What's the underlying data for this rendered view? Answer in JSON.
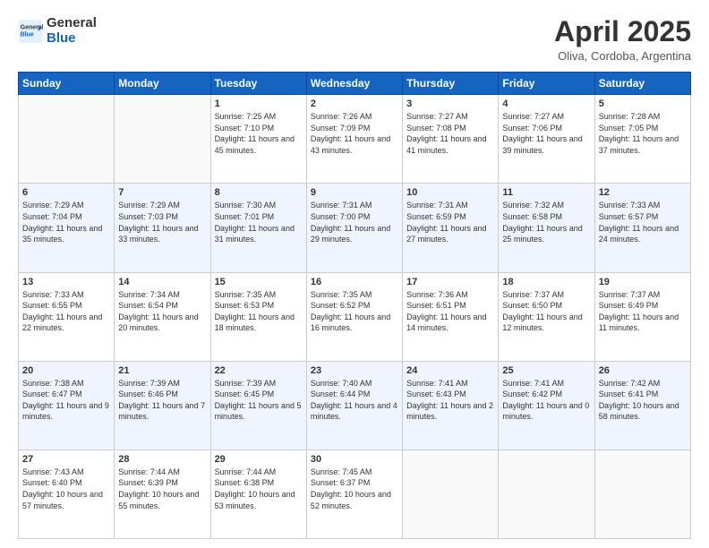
{
  "header": {
    "logo_general": "General",
    "logo_blue": "Blue",
    "month_title": "April 2025",
    "location": "Oliva, Cordoba, Argentina"
  },
  "days_of_week": [
    "Sunday",
    "Monday",
    "Tuesday",
    "Wednesday",
    "Thursday",
    "Friday",
    "Saturday"
  ],
  "weeks": [
    [
      {
        "day": "",
        "sunrise": "",
        "sunset": "",
        "daylight": ""
      },
      {
        "day": "",
        "sunrise": "",
        "sunset": "",
        "daylight": ""
      },
      {
        "day": "1",
        "sunrise": "Sunrise: 7:25 AM",
        "sunset": "Sunset: 7:10 PM",
        "daylight": "Daylight: 11 hours and 45 minutes."
      },
      {
        "day": "2",
        "sunrise": "Sunrise: 7:26 AM",
        "sunset": "Sunset: 7:09 PM",
        "daylight": "Daylight: 11 hours and 43 minutes."
      },
      {
        "day": "3",
        "sunrise": "Sunrise: 7:27 AM",
        "sunset": "Sunset: 7:08 PM",
        "daylight": "Daylight: 11 hours and 41 minutes."
      },
      {
        "day": "4",
        "sunrise": "Sunrise: 7:27 AM",
        "sunset": "Sunset: 7:06 PM",
        "daylight": "Daylight: 11 hours and 39 minutes."
      },
      {
        "day": "5",
        "sunrise": "Sunrise: 7:28 AM",
        "sunset": "Sunset: 7:05 PM",
        "daylight": "Daylight: 11 hours and 37 minutes."
      }
    ],
    [
      {
        "day": "6",
        "sunrise": "Sunrise: 7:29 AM",
        "sunset": "Sunset: 7:04 PM",
        "daylight": "Daylight: 11 hours and 35 minutes."
      },
      {
        "day": "7",
        "sunrise": "Sunrise: 7:29 AM",
        "sunset": "Sunset: 7:03 PM",
        "daylight": "Daylight: 11 hours and 33 minutes."
      },
      {
        "day": "8",
        "sunrise": "Sunrise: 7:30 AM",
        "sunset": "Sunset: 7:01 PM",
        "daylight": "Daylight: 11 hours and 31 minutes."
      },
      {
        "day": "9",
        "sunrise": "Sunrise: 7:31 AM",
        "sunset": "Sunset: 7:00 PM",
        "daylight": "Daylight: 11 hours and 29 minutes."
      },
      {
        "day": "10",
        "sunrise": "Sunrise: 7:31 AM",
        "sunset": "Sunset: 6:59 PM",
        "daylight": "Daylight: 11 hours and 27 minutes."
      },
      {
        "day": "11",
        "sunrise": "Sunrise: 7:32 AM",
        "sunset": "Sunset: 6:58 PM",
        "daylight": "Daylight: 11 hours and 25 minutes."
      },
      {
        "day": "12",
        "sunrise": "Sunrise: 7:33 AM",
        "sunset": "Sunset: 6:57 PM",
        "daylight": "Daylight: 11 hours and 24 minutes."
      }
    ],
    [
      {
        "day": "13",
        "sunrise": "Sunrise: 7:33 AM",
        "sunset": "Sunset: 6:55 PM",
        "daylight": "Daylight: 11 hours and 22 minutes."
      },
      {
        "day": "14",
        "sunrise": "Sunrise: 7:34 AM",
        "sunset": "Sunset: 6:54 PM",
        "daylight": "Daylight: 11 hours and 20 minutes."
      },
      {
        "day": "15",
        "sunrise": "Sunrise: 7:35 AM",
        "sunset": "Sunset: 6:53 PM",
        "daylight": "Daylight: 11 hours and 18 minutes."
      },
      {
        "day": "16",
        "sunrise": "Sunrise: 7:35 AM",
        "sunset": "Sunset: 6:52 PM",
        "daylight": "Daylight: 11 hours and 16 minutes."
      },
      {
        "day": "17",
        "sunrise": "Sunrise: 7:36 AM",
        "sunset": "Sunset: 6:51 PM",
        "daylight": "Daylight: 11 hours and 14 minutes."
      },
      {
        "day": "18",
        "sunrise": "Sunrise: 7:37 AM",
        "sunset": "Sunset: 6:50 PM",
        "daylight": "Daylight: 11 hours and 12 minutes."
      },
      {
        "day": "19",
        "sunrise": "Sunrise: 7:37 AM",
        "sunset": "Sunset: 6:49 PM",
        "daylight": "Daylight: 11 hours and 11 minutes."
      }
    ],
    [
      {
        "day": "20",
        "sunrise": "Sunrise: 7:38 AM",
        "sunset": "Sunset: 6:47 PM",
        "daylight": "Daylight: 11 hours and 9 minutes."
      },
      {
        "day": "21",
        "sunrise": "Sunrise: 7:39 AM",
        "sunset": "Sunset: 6:46 PM",
        "daylight": "Daylight: 11 hours and 7 minutes."
      },
      {
        "day": "22",
        "sunrise": "Sunrise: 7:39 AM",
        "sunset": "Sunset: 6:45 PM",
        "daylight": "Daylight: 11 hours and 5 minutes."
      },
      {
        "day": "23",
        "sunrise": "Sunrise: 7:40 AM",
        "sunset": "Sunset: 6:44 PM",
        "daylight": "Daylight: 11 hours and 4 minutes."
      },
      {
        "day": "24",
        "sunrise": "Sunrise: 7:41 AM",
        "sunset": "Sunset: 6:43 PM",
        "daylight": "Daylight: 11 hours and 2 minutes."
      },
      {
        "day": "25",
        "sunrise": "Sunrise: 7:41 AM",
        "sunset": "Sunset: 6:42 PM",
        "daylight": "Daylight: 11 hours and 0 minutes."
      },
      {
        "day": "26",
        "sunrise": "Sunrise: 7:42 AM",
        "sunset": "Sunset: 6:41 PM",
        "daylight": "Daylight: 10 hours and 58 minutes."
      }
    ],
    [
      {
        "day": "27",
        "sunrise": "Sunrise: 7:43 AM",
        "sunset": "Sunset: 6:40 PM",
        "daylight": "Daylight: 10 hours and 57 minutes."
      },
      {
        "day": "28",
        "sunrise": "Sunrise: 7:44 AM",
        "sunset": "Sunset: 6:39 PM",
        "daylight": "Daylight: 10 hours and 55 minutes."
      },
      {
        "day": "29",
        "sunrise": "Sunrise: 7:44 AM",
        "sunset": "Sunset: 6:38 PM",
        "daylight": "Daylight: 10 hours and 53 minutes."
      },
      {
        "day": "30",
        "sunrise": "Sunrise: 7:45 AM",
        "sunset": "Sunset: 6:37 PM",
        "daylight": "Daylight: 10 hours and 52 minutes."
      },
      {
        "day": "",
        "sunrise": "",
        "sunset": "",
        "daylight": ""
      },
      {
        "day": "",
        "sunrise": "",
        "sunset": "",
        "daylight": ""
      },
      {
        "day": "",
        "sunrise": "",
        "sunset": "",
        "daylight": ""
      }
    ]
  ]
}
